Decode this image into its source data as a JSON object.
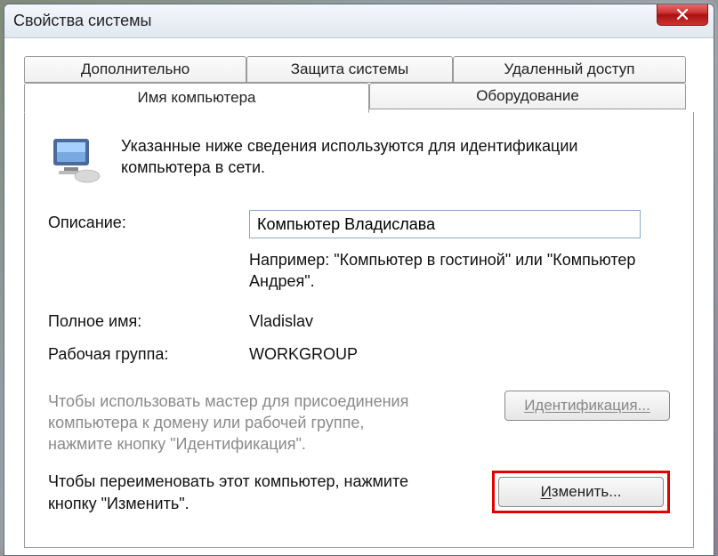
{
  "window": {
    "title": "Свойства системы"
  },
  "tabs": {
    "advanced": "Дополнительно",
    "protection": "Защита системы",
    "remote": "Удаленный доступ",
    "computer_name": "Имя компьютера",
    "hardware": "Оборудование"
  },
  "panel": {
    "intro": "Указанные ниже сведения используются для идентификации компьютера в сети.",
    "description_label": "Описание:",
    "description_value": "Компьютер Владислава",
    "description_hint": "Например: \"Компьютер в гостиной\" или \"Компьютер Андрея\".",
    "fullname_label": "Полное имя:",
    "fullname_value": "Vladislav",
    "workgroup_label": "Рабочая группа:",
    "workgroup_value": "WORKGROUP",
    "wizard_text": "Чтобы использовать мастер для присоединения компьютера к домену или рабочей группе, нажмите кнопку \"Идентификация\".",
    "identify_button": "Идентификация...",
    "rename_text": "Чтобы переименовать этот компьютер, нажмите кнопку \"Изменить\".",
    "change_button_u": "И",
    "change_button_rest": "зменить..."
  }
}
